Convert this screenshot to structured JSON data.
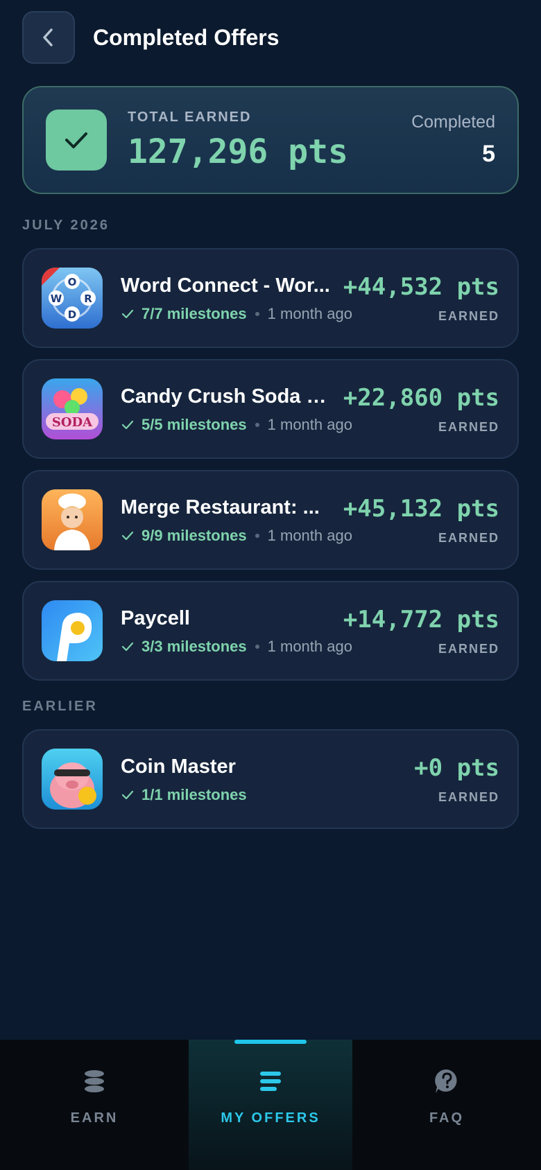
{
  "header": {
    "title": "Completed Offers"
  },
  "summary": {
    "total_label": "TOTAL EARNED",
    "total_value": "127,296 pts",
    "completed_label": "Completed",
    "completed_count": "5"
  },
  "sections": [
    {
      "label": "JULY 2026",
      "offers": [
        {
          "name": "Word Connect - Wor...",
          "milestones": "7/7 milestones",
          "time": "1 month ago",
          "points": "+44,532 pts",
          "earned_label": "EARNED"
        },
        {
          "name": "Candy Crush Soda S...",
          "milestones": "5/5 milestones",
          "time": "1 month ago",
          "points": "+22,860 pts",
          "earned_label": "EARNED"
        },
        {
          "name": "Merge Restaurant: ...",
          "milestones": "9/9 milestones",
          "time": "1 month ago",
          "points": "+45,132 pts",
          "earned_label": "EARNED"
        },
        {
          "name": "Paycell",
          "milestones": "3/3 milestones",
          "time": "1 month ago",
          "points": "+14,772 pts",
          "earned_label": "EARNED"
        }
      ]
    },
    {
      "label": "EARLIER",
      "offers": [
        {
          "name": "Coin Master",
          "milestones": "1/1 milestones",
          "points": "+0 pts",
          "earned_label": "EARNED"
        }
      ]
    }
  ],
  "nav": {
    "items": [
      {
        "label": "EARN",
        "icon": "stack-icon"
      },
      {
        "label": "MY OFFERS",
        "icon": "list-icon",
        "active": true
      },
      {
        "label": "FAQ",
        "icon": "help-icon"
      }
    ]
  },
  "colors": {
    "accent": "#7fd3ad",
    "nav_active": "#2cc8ea",
    "background": "#0b1a2e"
  }
}
